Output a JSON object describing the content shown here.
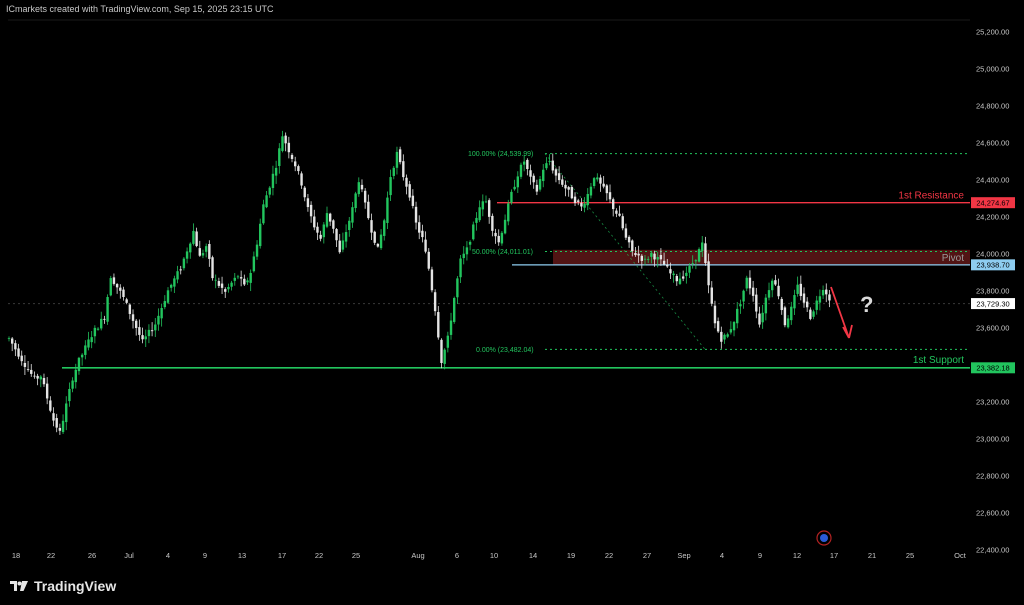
{
  "header": {
    "attribution": "ICmarkets created with TradingView.com, Sep 15, 2025 23:15 UTC"
  },
  "brand": {
    "name": "TradingView",
    "logo_icon": "tradingview-logo-icon"
  },
  "colors": {
    "up": "#22c55e",
    "down": "#e5e5e5",
    "resistance": "#f23645",
    "support": "#22c55e",
    "pivot_line": "#8ecdf0",
    "pivot_zone": "#5a1616",
    "fib": "#22c55e",
    "arrow": "#f23645",
    "question": "#d9d9d9",
    "axis_text": "#c8c8c8",
    "label_text": "#000000"
  },
  "chart_data": {
    "type": "candlestick",
    "title": "",
    "ylim": [
      22250,
      25550
    ],
    "y_ticks": [
      22400,
      22600,
      22800,
      23000,
      23200,
      23400,
      23600,
      23800,
      24000,
      24200,
      24400,
      24600,
      24800,
      25000,
      25200,
      25400
    ],
    "y_tick_labels": [
      "22,400.00",
      "22,600.00",
      "22,800.00",
      "23,000.00",
      "23,200.00",
      "23,400.00",
      "23,600.00",
      "23,800.00",
      "24,000.00",
      "24,200.00",
      "24,400.00",
      "24,600.00",
      "24,800.00",
      "25,000.00",
      "25,200.00",
      "25,400.00"
    ],
    "x_labels": [
      "18",
      "22",
      "26",
      "Jul",
      "4",
      "9",
      "13",
      "17",
      "22",
      "25",
      "Aug",
      "6",
      "10",
      "14",
      "19",
      "22",
      "27",
      "Sep",
      "4",
      "9",
      "12",
      "17",
      "21",
      "25",
      "Oct"
    ],
    "levels": [
      {
        "name": "1st Resistance",
        "value": 24274.67,
        "label": "24,274.67",
        "kind": "resistance"
      },
      {
        "name": "Pivot",
        "value": 23938.7,
        "label": "23,938.70",
        "kind": "pivot"
      },
      {
        "name": "1st Support",
        "value": 23382.18,
        "label": "23,382.18",
        "kind": "support"
      }
    ],
    "current_price": {
      "value": 23729.3,
      "label": "23,729.30"
    },
    "pivot_zone": [
      23938.7,
      24020
    ],
    "fibonacci": [
      {
        "label": "100.00% (24,539.99)",
        "value": 24539.99
      },
      {
        "label": "50.00% (24,011.01)",
        "value": 24011.01
      },
      {
        "label": "0.00% (23,482.04)",
        "value": 23482.04
      }
    ],
    "question_mark": "?",
    "price_path": [
      [
        0,
        23540
      ],
      [
        2,
        23430
      ],
      [
        4,
        23320
      ],
      [
        5,
        23340
      ],
      [
        6,
        23220
      ],
      [
        7,
        23100
      ],
      [
        8,
        23030
      ],
      [
        9,
        23180
      ],
      [
        10,
        23330
      ],
      [
        11,
        23420
      ],
      [
        13,
        23560
      ],
      [
        15,
        23660
      ],
      [
        16,
        23880
      ],
      [
        18,
        23760
      ],
      [
        20,
        23600
      ],
      [
        21,
        23520
      ],
      [
        23,
        23620
      ],
      [
        25,
        23800
      ],
      [
        27,
        23920
      ],
      [
        29,
        24120
      ],
      [
        30,
        23980
      ],
      [
        31,
        24040
      ],
      [
        32,
        23870
      ],
      [
        34,
        23790
      ],
      [
        35,
        23840
      ],
      [
        36,
        23880
      ],
      [
        37,
        23820
      ],
      [
        38,
        23900
      ],
      [
        39,
        24060
      ],
      [
        40,
        24260
      ],
      [
        42,
        24480
      ],
      [
        43,
        24640
      ],
      [
        44,
        24560
      ],
      [
        45,
        24480
      ],
      [
        46,
        24380
      ],
      [
        47,
        24240
      ],
      [
        48,
        24150
      ],
      [
        49,
        24080
      ],
      [
        50,
        24220
      ],
      [
        51,
        24140
      ],
      [
        52,
        24000
      ],
      [
        53,
        24120
      ],
      [
        54,
        24240
      ],
      [
        55,
        24400
      ],
      [
        56,
        24260
      ],
      [
        57,
        24130
      ],
      [
        58,
        24020
      ],
      [
        59,
        24180
      ],
      [
        60,
        24420
      ],
      [
        61,
        24540
      ],
      [
        62,
        24420
      ],
      [
        63,
        24320
      ],
      [
        64,
        24160
      ],
      [
        65,
        24080
      ],
      [
        66,
        23920
      ],
      [
        67,
        23700
      ],
      [
        68,
        23420
      ],
      [
        69,
        23540
      ],
      [
        70,
        23760
      ],
      [
        71,
        23960
      ],
      [
        72,
        24020
      ],
      [
        73,
        24140
      ],
      [
        74,
        24260
      ],
      [
        75,
        24280
      ],
      [
        76,
        24140
      ],
      [
        77,
        24060
      ],
      [
        78,
        24190
      ],
      [
        79,
        24320
      ],
      [
        80,
        24430
      ],
      [
        81,
        24500
      ],
      [
        82,
        24400
      ],
      [
        83,
        24340
      ],
      [
        84,
        24460
      ],
      [
        85,
        24500
      ],
      [
        86,
        24420
      ],
      [
        87,
        24380
      ],
      [
        88,
        24330
      ],
      [
        89,
        24290
      ],
      [
        90,
        24250
      ],
      [
        91,
        24320
      ],
      [
        92,
        24420
      ],
      [
        93,
        24370
      ],
      [
        94,
        24320
      ],
      [
        95,
        24250
      ],
      [
        96,
        24190
      ],
      [
        97,
        24080
      ],
      [
        98,
        24010
      ],
      [
        99,
        23990
      ],
      [
        100,
        23960
      ],
      [
        101,
        24000
      ],
      [
        102,
        23970
      ],
      [
        103,
        23940
      ],
      [
        104,
        23890
      ],
      [
        105,
        23860
      ],
      [
        106,
        23880
      ],
      [
        107,
        23920
      ],
      [
        108,
        23980
      ],
      [
        109,
        24050
      ],
      [
        110,
        23820
      ],
      [
        111,
        23620
      ],
      [
        112,
        23540
      ],
      [
        113,
        23560
      ],
      [
        114,
        23640
      ],
      [
        115,
        23740
      ],
      [
        116,
        23860
      ],
      [
        117,
        23780
      ],
      [
        118,
        23620
      ],
      [
        119,
        23760
      ],
      [
        120,
        23870
      ],
      [
        121,
        23780
      ],
      [
        122,
        23620
      ],
      [
        123,
        23700
      ],
      [
        124,
        23820
      ],
      [
        125,
        23740
      ],
      [
        126,
        23660
      ],
      [
        127,
        23740
      ],
      [
        128,
        23820
      ],
      [
        129,
        23760
      ]
    ]
  }
}
